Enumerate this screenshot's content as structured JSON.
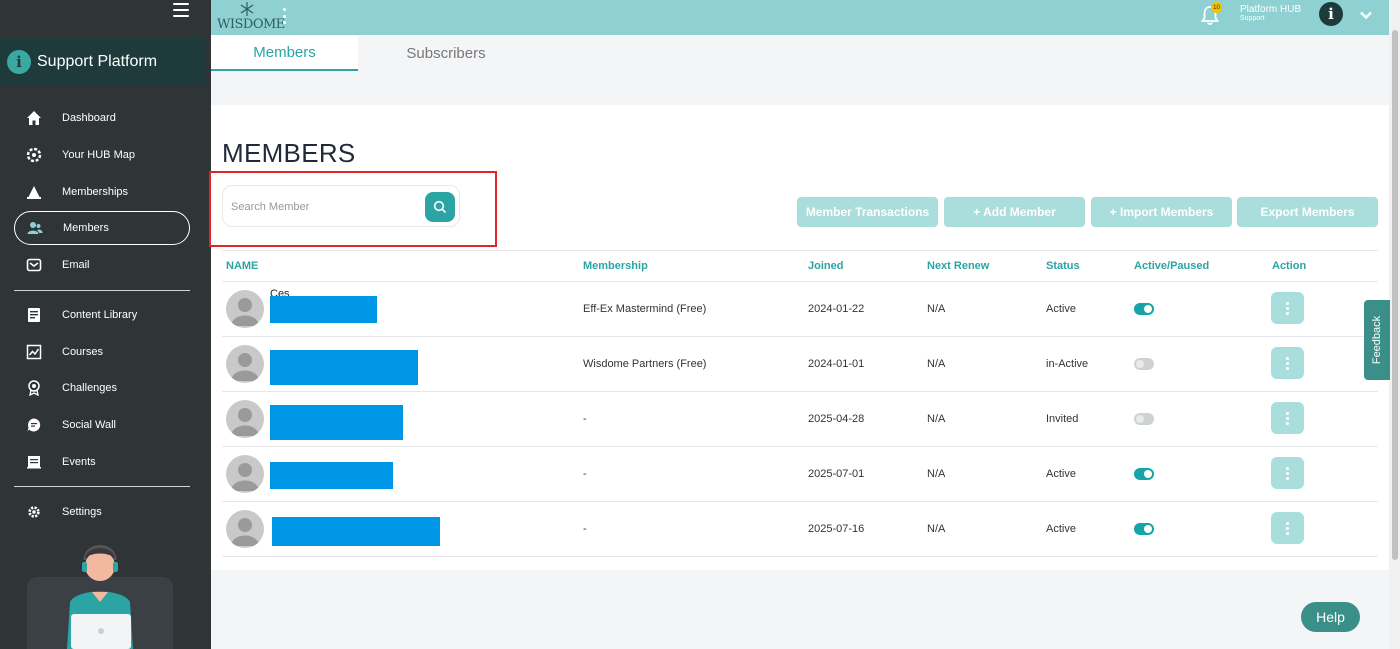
{
  "sidebar": {
    "brand_label": "Support Platform",
    "items": [
      {
        "label": "Dashboard",
        "icon": "home-icon"
      },
      {
        "label": "Your HUB Map",
        "icon": "hub-map-icon"
      },
      {
        "label": "Memberships",
        "icon": "memberships-icon"
      },
      {
        "label": "Members",
        "icon": "members-icon",
        "active": true
      },
      {
        "label": "Email",
        "icon": "email-icon"
      },
      {
        "label": "Content Library",
        "icon": "content-library-icon"
      },
      {
        "label": "Courses",
        "icon": "courses-icon"
      },
      {
        "label": "Challenges",
        "icon": "challenges-icon"
      },
      {
        "label": "Social Wall",
        "icon": "social-wall-icon"
      },
      {
        "label": "Events",
        "icon": "events-icon"
      },
      {
        "label": "Settings",
        "icon": "gear-icon"
      }
    ]
  },
  "topbar": {
    "logo_text": "WISDOME",
    "notification_count": "10",
    "hub_name": "Platform HUB",
    "hub_sub": "Support"
  },
  "tabs": [
    {
      "label": "Members",
      "active": true
    },
    {
      "label": "Subscribers",
      "active": false
    }
  ],
  "main": {
    "title": "MEMBERS",
    "search_placeholder": "Search Member",
    "buttons": {
      "transactions": "Member Transactions",
      "add": "+ Add Member",
      "import": "+ Import Members",
      "export": "Export Members"
    },
    "columns": [
      "NAME",
      "Membership",
      "Joined",
      "Next Renew",
      "Status",
      "Active/Paused",
      "Action"
    ],
    "rows": [
      {
        "name": "Ces",
        "membership": "Eff-Ex Mastermind (Free)",
        "joined": "2024-01-22",
        "next_renew": "N/A",
        "status": "Active",
        "active": true
      },
      {
        "name": "",
        "membership": "Wisdome Partners (Free)",
        "joined": "2024-01-01",
        "next_renew": "N/A",
        "status": "in-Active",
        "active": false
      },
      {
        "name": "",
        "membership": "-",
        "joined": "2025-04-28",
        "next_renew": "N/A",
        "status": "Invited",
        "active": false
      },
      {
        "name": "",
        "membership": "-",
        "joined": "2025-07-01",
        "next_renew": "N/A",
        "status": "Active",
        "active": true
      },
      {
        "name": "",
        "membership": "-",
        "joined": "2025-07-16",
        "next_renew": "N/A",
        "status": "Active",
        "active": true
      }
    ]
  },
  "feedback_label": "Feedback",
  "help_label": "Help",
  "colors": {
    "accent": "#2aa5a3",
    "sidebar_bg": "#2f3437",
    "topbar_bg": "#8fd0d2",
    "button_bg": "#a9dedd",
    "highlight": "#e0262a",
    "redaction": "#0096e6"
  }
}
